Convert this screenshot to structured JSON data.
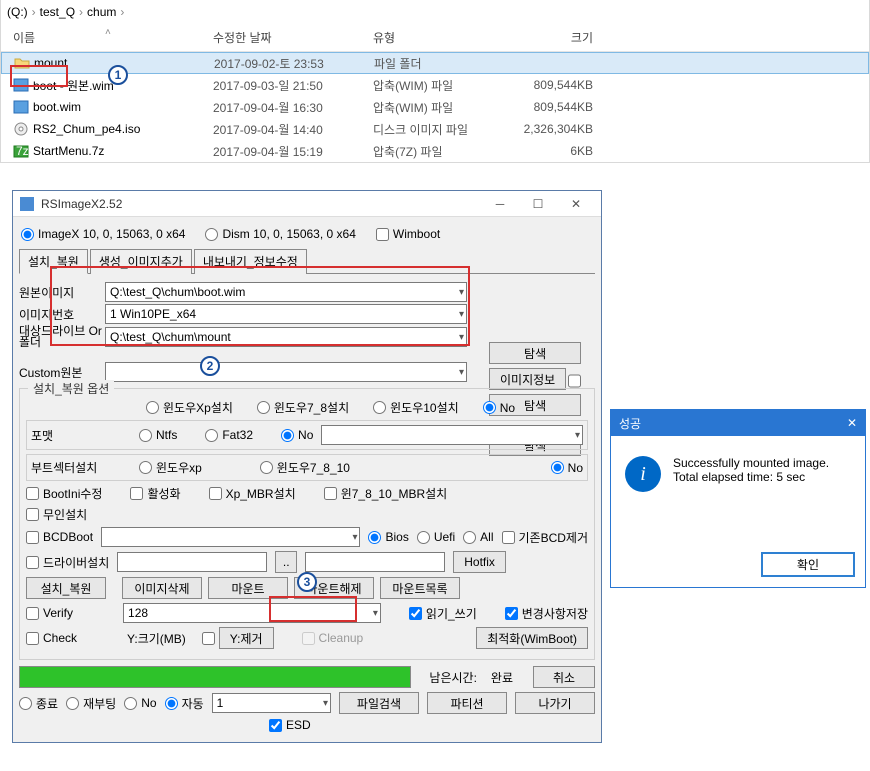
{
  "breadcrumb": {
    "root": "(Q:)",
    "p1": "test_Q",
    "p2": "chum",
    "sep": "›"
  },
  "columns": {
    "name": "이름",
    "date": "수정한 날짜",
    "type": "유형",
    "size": "크기"
  },
  "files": [
    {
      "name": "mount",
      "date": "2017-09-02-토 23:53",
      "type": "파일 폴더",
      "size": ""
    },
    {
      "name": "boot - 원본.wim",
      "date": "2017-09-03-일 21:50",
      "type": "압축(WIM) 파일",
      "size": "809,544KB"
    },
    {
      "name": "boot.wim",
      "date": "2017-09-04-월 16:30",
      "type": "압축(WIM) 파일",
      "size": "809,544KB"
    },
    {
      "name": "RS2_Chum_pe4.iso",
      "date": "2017-09-04-월 14:40",
      "type": "디스크 이미지 파일",
      "size": "2,326,304KB"
    },
    {
      "name": "StartMenu.7z",
      "date": "2017-09-04-월 15:19",
      "type": "압축(7Z) 파일",
      "size": "6KB"
    }
  ],
  "rs": {
    "title": "RSImageX2.52",
    "mode1": "ImageX 10, 0, 15063, 0 x64",
    "mode2": "Dism 10, 0, 15063, 0 x64",
    "wimboot": "Wimboot",
    "tabs": {
      "t1": "설치_복원",
      "t2": "생성_이미지추가",
      "t3": "내보내기_정보수정"
    },
    "lbl": {
      "srcimg": "원본이미지",
      "imgno": "이미지번호",
      "tgtdrv": "대상드라이브 Or 폴더",
      "custom": "Custom원본",
      "browse": "탐색",
      "imginfo": "이미지정보",
      "grouptitle": "설치_복원 옵션",
      "winxp": "윈도우Xp설치",
      "win78": "윈도우7_8설치",
      "win10": "윈도우10설치",
      "no": "No",
      "format": "포맷",
      "ntfs": "Ntfs",
      "fat32": "Fat32",
      "bootsec": "부트섹터설치",
      "bsxp": "윈도우xp",
      "bs78": "윈도우7_8_10",
      "bootini": "BootIni수정",
      "activate": "활성화",
      "xpmbr": "Xp_MBR설치",
      "win78mbr": "윈7_8_10_MBR설치",
      "unattend": "무인설치",
      "bcdboot": "BCDBoot",
      "bios": "Bios",
      "uefi": "Uefi",
      "all": "All",
      "keepbcd": "기존BCD제거",
      "driver": "드라이버설치",
      "dotdot": "..",
      "hotfix": "Hotfix",
      "restore": "설치_복원",
      "delimg": "이미지삭제",
      "mount": "마운트",
      "unmount": "마운트해제",
      "mountlist": "마운트목록",
      "verify": "Verify",
      "check": "Check",
      "rw": "읽기_쓰기",
      "savechg": "변경사항저장",
      "ysize": "Y:크기(MB)",
      "yremove": "Y:제거",
      "cleanup": "Cleanup",
      "optim": "최적화(WimBoot)",
      "remain": "남은시간:",
      "done": "완료",
      "cancel": "취소",
      "exit": "종료",
      "reboot": "재부팅",
      "auto": "자동",
      "filesearch": "파일검색",
      "partition": "파티션",
      "leave": "나가기",
      "esd": "ESD"
    },
    "val": {
      "srcimg": "Q:\\test_Q\\chum\\boot.wim",
      "imgno": "1  Win10PE_x64",
      "tgtdrv": "Q:\\test_Q\\chum\\mount",
      "ysize": "128",
      "spin": "1"
    }
  },
  "succ": {
    "title": "성공",
    "line1": "Successfully mounted image.",
    "line2": "Total elapsed time: 5 sec",
    "ok": "확인"
  },
  "ann": {
    "n1": "1",
    "n2": "2",
    "n3": "3"
  }
}
